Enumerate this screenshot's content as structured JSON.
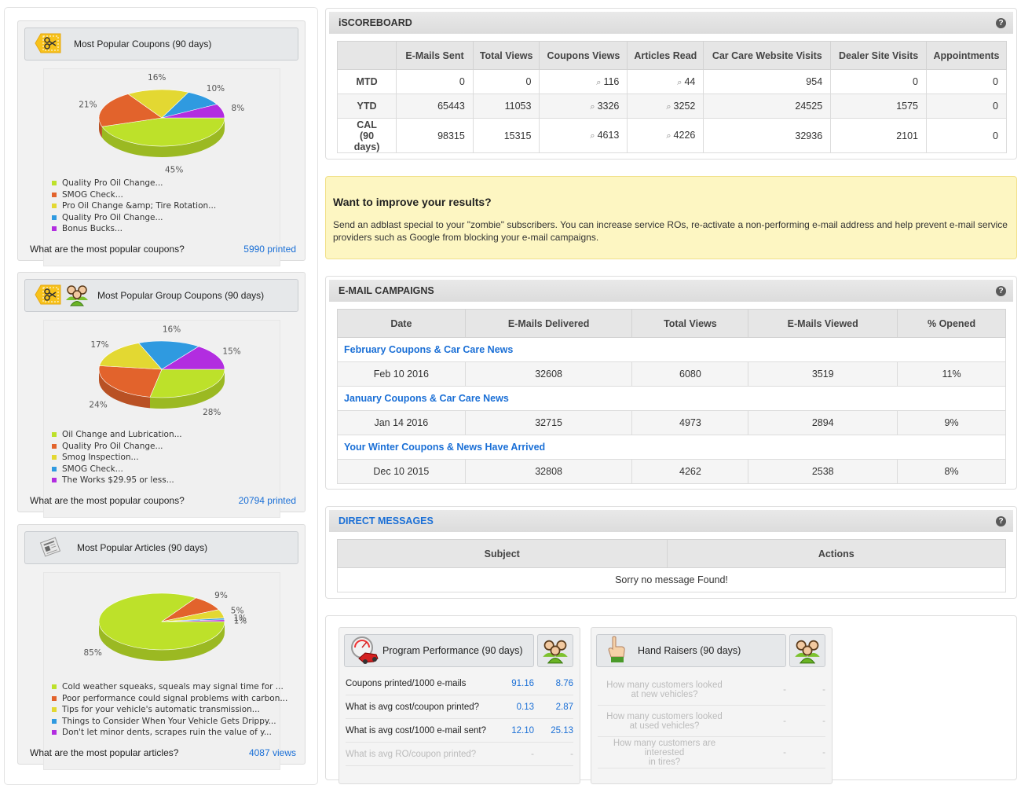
{
  "left_cards": [
    {
      "title": "Most Popular Coupons (90 days)",
      "icons": [
        "coupon-scissors-icon"
      ],
      "question": "What are the most popular coupons?",
      "count_link": "5990 printed"
    },
    {
      "title": "Most Popular Group Coupons (90 days)",
      "icons": [
        "coupon-scissors-icon",
        "group-users-icon"
      ],
      "question": "What are the most popular coupons?",
      "count_link": "20794 printed"
    },
    {
      "title": "Most Popular Articles (90 days)",
      "icons": [
        "newspaper-icon"
      ],
      "question": "What are the most popular articles?",
      "count_link": "4087 views"
    }
  ],
  "colors": {
    "slice_green": "#bde12a",
    "slice_orange": "#e2632c",
    "slice_yellow": "#e3d832",
    "slice_blue": "#2f9ae0",
    "slice_purple": "#b22de0",
    "link_blue": "#1a6fd6",
    "alert_bg": "#fdf6c2"
  },
  "chart_data": [
    {
      "type": "pie",
      "title": "Most Popular Coupons (90 days)",
      "categories": [
        "Quality Pro Oil Change...",
        "SMOG Check...",
        "Pro Oil Change &amp; Tire Rotation...",
        "Quality Pro Oil Change...",
        "Bonus Bucks..."
      ],
      "values": [
        45,
        21,
        16,
        10,
        8
      ],
      "labels": [
        "45%",
        "21%",
        "16%",
        "10%",
        "8%"
      ],
      "colors": [
        "#bde12a",
        "#e2632c",
        "#e3d832",
        "#2f9ae0",
        "#b22de0"
      ],
      "legend": "bottom"
    },
    {
      "type": "pie",
      "title": "Most Popular Group Coupons (90 days)",
      "categories": [
        "Oil Change and Lubrication...",
        "Quality Pro Oil Change...",
        "Smog Inspection...",
        "SMOG Check...",
        "The Works $29.95 or less..."
      ],
      "values": [
        28,
        24,
        17,
        16,
        15
      ],
      "labels": [
        "28%",
        "24%",
        "17%",
        "16%",
        "15%"
      ],
      "colors": [
        "#bde12a",
        "#e2632c",
        "#e3d832",
        "#2f9ae0",
        "#b22de0"
      ],
      "legend": "bottom"
    },
    {
      "type": "pie",
      "title": "Most Popular Articles (90 days)",
      "categories": [
        "Cold weather squeaks, squeals may signal time for ...",
        "Poor performance could signal problems with carbon...",
        "Tips for your vehicle's automatic transmission...",
        "Things to Consider When Your Vehicle Gets Drippy...",
        "Don't let minor dents, scrapes ruin the value of y..."
      ],
      "values": [
        85,
        9,
        5,
        1,
        1
      ],
      "labels": [
        "85%",
        "9%",
        "5%",
        "1%",
        "1%"
      ],
      "colors": [
        "#bde12a",
        "#e2632c",
        "#e3d832",
        "#2f9ae0",
        "#b22de0"
      ],
      "legend": "bottom"
    }
  ],
  "scoreboard": {
    "title": "iSCOREBOARD",
    "columns": [
      "",
      "E-Mails Sent",
      "Total Views",
      "Coupons Views",
      "Articles Read",
      "Car Care Website Visits",
      "Dealer Site Visits",
      "Appointments"
    ],
    "rows": [
      {
        "label": "MTD",
        "label2": "",
        "values": [
          "0",
          "0",
          "116",
          "44",
          "954",
          "0",
          "0"
        ]
      },
      {
        "label": "YTD",
        "label2": "",
        "values": [
          "65443",
          "11053",
          "3326",
          "3252",
          "24525",
          "1575",
          "0"
        ]
      },
      {
        "label": "CAL",
        "label2": "(90 days)",
        "values": [
          "98315",
          "15315",
          "4613",
          "4226",
          "32936",
          "2101",
          "0"
        ]
      }
    ]
  },
  "alert": {
    "heading": "Want to improve your results?",
    "body": "Send an adblast special to your \"zombie\" subscribers. You can increase service ROs, re-activate a non-performing e-mail address and help prevent e-mail service providers such as Google from blocking your e-mail campaigns."
  },
  "campaigns": {
    "title": "E-MAIL CAMPAIGNS",
    "columns": [
      "Date",
      "E-Mails Delivered",
      "Total Views",
      "E-Mails Viewed",
      "% Opened"
    ],
    "items": [
      {
        "name": "February Coupons & Car Care News",
        "date": "Feb 10 2016",
        "delivered": "32608",
        "views": "6080",
        "viewed": "3519",
        "opened": "11%"
      },
      {
        "name": "January Coupons & Car Care News",
        "date": "Jan 14 2016",
        "delivered": "32715",
        "views": "4973",
        "viewed": "2894",
        "opened": "9%"
      },
      {
        "name": "Your Winter Coupons & News Have Arrived",
        "date": "Dec 10 2015",
        "delivered": "32808",
        "views": "4262",
        "viewed": "2538",
        "opened": "8%"
      }
    ]
  },
  "messages": {
    "title": "DIRECT MESSAGES",
    "columns": [
      "Subject",
      "Actions"
    ],
    "empty": "Sorry no message Found!"
  },
  "performance": {
    "title": "Program Performance (90 days)",
    "rows": [
      {
        "label": "Coupons printed/1000 e-mails",
        "v1": "91.16",
        "v2": "8.76"
      },
      {
        "label": "What is avg cost/coupon printed?",
        "v1": "0.13",
        "v2": "2.87"
      },
      {
        "label": "What is avg cost/1000 e-mail sent?",
        "v1": "12.10",
        "v2": "25.13"
      },
      {
        "label": "What is avg RO/coupon printed?",
        "v1": "-",
        "v2": "-"
      }
    ]
  },
  "hand_raisers": {
    "title": "Hand Raisers (90 days)",
    "rows": [
      {
        "line1": "How many customers looked",
        "line2": "at new vehicles?",
        "v1": "-",
        "v2": "-"
      },
      {
        "line1": "How many customers looked",
        "line2": "at used vehicles?",
        "v1": "-",
        "v2": "-"
      },
      {
        "line1": "How many customers are interested",
        "line2": "in tires?",
        "v1": "-",
        "v2": "-"
      }
    ]
  },
  "help_glyph": "?",
  "magnifier_glyph": "⌕"
}
